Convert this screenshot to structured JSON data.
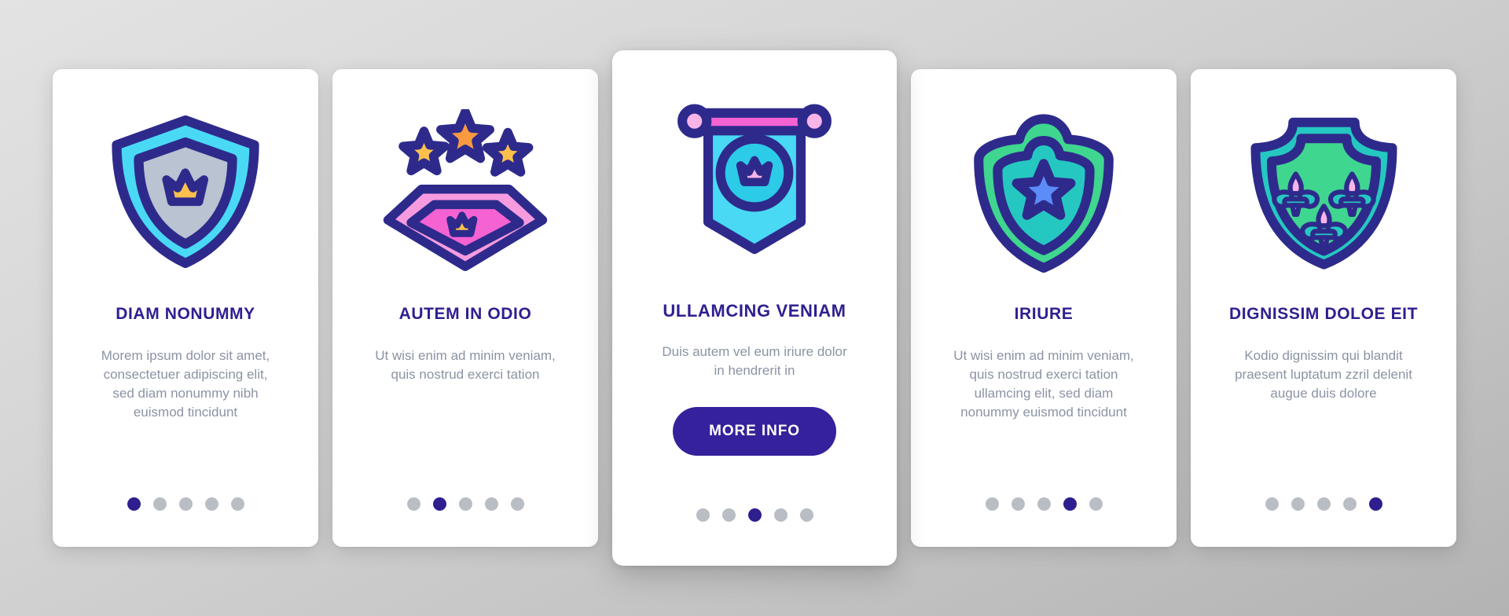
{
  "background": {
    "color_top": "#e3e3e3",
    "color_bottom": "#b3b3b3"
  },
  "colors": {
    "title": "#2e1f8f",
    "body_text": "#8b93a4",
    "accent": "#35219b",
    "dot_inactive": "#b9bdc4",
    "dot_active": "#2e1f8f",
    "card_bg": "#ffffff",
    "stroke": "#2e2a8c",
    "cyan": "#4ad9f5",
    "cyan_dark": "#2ccbe8",
    "grey_blue": "#b9c3d1",
    "yellow": "#fcc14d",
    "orange": "#f99a40",
    "pink": "#f562d2",
    "pink_light": "#f79be0",
    "pink_pale": "#f9b4e8",
    "green": "#3fd68f",
    "teal": "#25c8c0",
    "blue": "#5b8cf7"
  },
  "cards": [
    {
      "id": "card-1",
      "icon": "shield-crown-icon",
      "title": "DIAM NONUMMY",
      "body": "Morem ipsum dolor sit amet, consectetuer adipiscing elit, sed diam nonummy nibh euismod tincidunt",
      "featured": false,
      "dots_total": 5,
      "dots_active": 1,
      "button": null
    },
    {
      "id": "card-2",
      "icon": "diamond-stars-crown-icon",
      "title": "AUTEM IN ODIO",
      "body": "Ut wisi enim ad minim veniam, quis nostrud exerci tation",
      "featured": false,
      "dots_total": 5,
      "dots_active": 2,
      "button": null
    },
    {
      "id": "card-3",
      "icon": "banner-crown-icon",
      "title": "ULLAMCING VENIAM",
      "body": "Duis autem vel eum iriure dolor in hendrerit in",
      "featured": true,
      "dots_total": 5,
      "dots_active": 3,
      "button": "MORE INFO"
    },
    {
      "id": "card-4",
      "icon": "shield-star-icon",
      "title": "IRIURE",
      "body": "Ut wisi enim ad minim veniam, quis nostrud exerci tation ullamcing elit, sed diam nonummy euismod tincidunt",
      "featured": false,
      "dots_total": 5,
      "dots_active": 4,
      "button": null
    },
    {
      "id": "card-5",
      "icon": "shield-fleur-de-lis-icon",
      "title": "DIGNISSIM DOLOE EIT",
      "body": "Kodio dignissim qui blandit praesent luptatum zzril delenit augue duis dolore",
      "featured": false,
      "dots_total": 5,
      "dots_active": 5,
      "button": null
    }
  ]
}
